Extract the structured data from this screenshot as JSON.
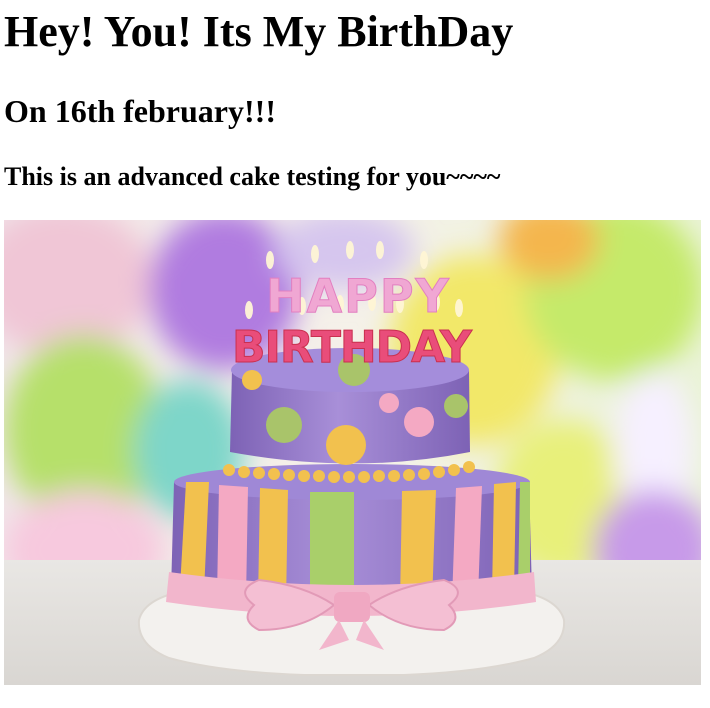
{
  "page": {
    "heading_main": "Hey! You! Its My BirthDay",
    "heading_date": "On 16th february!!!",
    "heading_sub": "This is an advanced cake testing for you~~~~"
  },
  "image": {
    "candle_text_top": "HAPPY",
    "candle_text_bottom": "BIRTHDAY",
    "palette": {
      "cake_purple": "#9b7fcf",
      "cake_purple_dark": "#7d62b5",
      "ribbon_pink": "#f2b6cc",
      "stripe_yellow": "#f2c14e",
      "stripe_green": "#a9cf6a",
      "stripe_pink": "#f4a9c3",
      "board_white": "#f3f1ee"
    }
  }
}
